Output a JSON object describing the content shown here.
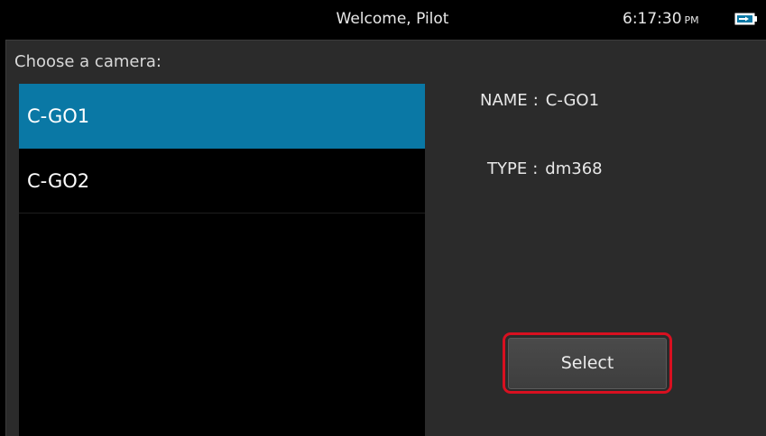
{
  "status_bar": {
    "title": "Welcome, Pilot",
    "time": "6:17:30",
    "ampm": "PM",
    "battery_icon": "battery-charging-icon"
  },
  "dialog": {
    "title": "Choose a camera:"
  },
  "cameras": [
    {
      "label": "C-GO1",
      "selected": true
    },
    {
      "label": "C-GO2",
      "selected": false
    }
  ],
  "details": {
    "name_label": "NAME",
    "name_value": "C-GO1",
    "type_label": "TYPE",
    "type_value": "dm368",
    "separator": ":"
  },
  "actions": {
    "select_label": "Select"
  },
  "colors": {
    "selection": "#0a78a5",
    "highlight_border": "#d81020",
    "dialog_bg": "#2b2b2b"
  }
}
